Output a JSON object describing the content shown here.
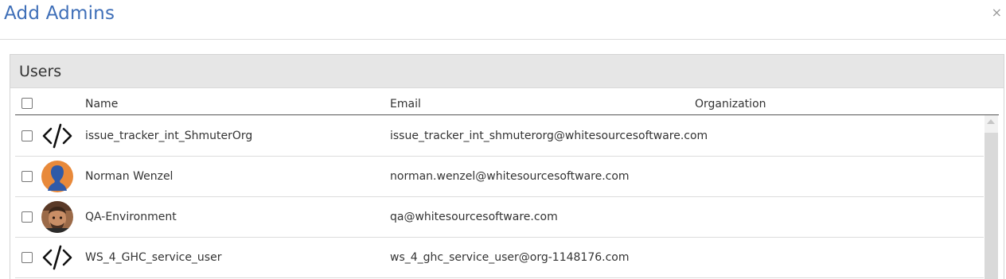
{
  "dialog": {
    "title": "Add Admins",
    "close_glyph": "×"
  },
  "users_panel": {
    "title": "Users",
    "columns": {
      "name": "Name",
      "email": "Email",
      "organization": "Organization"
    },
    "rows": [
      {
        "avatar": "code-icon",
        "name": "issue_tracker_int_ShmuterOrg",
        "email": "issue_tracker_int_shmuterorg@whitesourcesoftware.com",
        "organization": "",
        "checked": false
      },
      {
        "avatar": "person-silhouette-avatar",
        "name": "Norman Wenzel",
        "email": "norman.wenzel@whitesourcesoftware.com",
        "organization": "",
        "checked": false
      },
      {
        "avatar": "user-photo-avatar",
        "name": "QA-Environment",
        "email": "qa@whitesourcesoftware.com",
        "organization": "",
        "checked": false
      },
      {
        "avatar": "code-icon",
        "name": "WS_4_GHC_service_user",
        "email": "ws_4_ghc_service_user@org-1148176.com",
        "organization": "",
        "checked": false
      }
    ]
  },
  "colors": {
    "title_blue": "#3f6fb8",
    "panel_heading_bg": "#e6e6e6",
    "avatar_orange": "#e8893a",
    "avatar_blue": "#2f5aa8"
  }
}
